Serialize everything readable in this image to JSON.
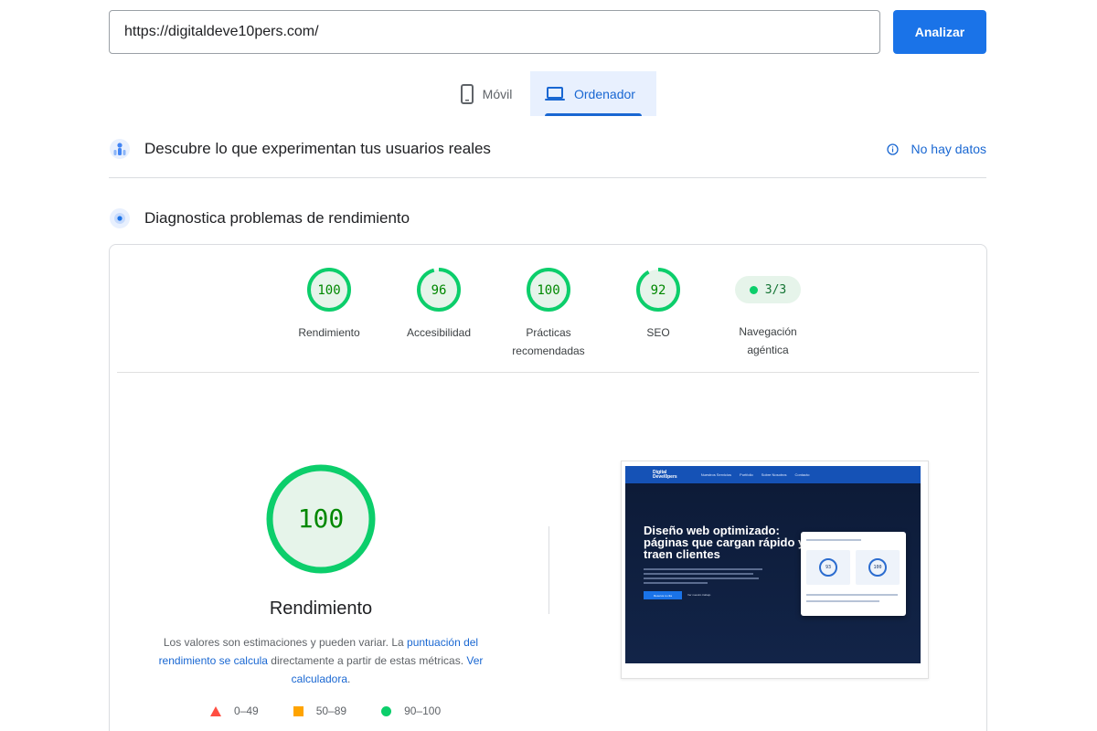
{
  "url_bar": {
    "value": "https://digitaldeve10pers.com/",
    "analyze_label": "Analizar"
  },
  "device_tabs": {
    "mobile_label": "Móvil",
    "desktop_label": "Ordenador",
    "selected": "Ordenador"
  },
  "crux_section": {
    "title": "Descubre lo que experimentan tus usuarios reales",
    "status_link": "No hay datos"
  },
  "diagnostics_section": {
    "title": "Diagnostica problemas de rendimiento"
  },
  "scores": [
    {
      "label": "Rendimiento",
      "value": "100",
      "fraction": 1.0
    },
    {
      "label": "Accesibilidad",
      "value": "96",
      "fraction": 0.96
    },
    {
      "label_line1": "Prácticas",
      "label_line2": "recomendadas",
      "value": "100",
      "fraction": 1.0
    },
    {
      "label": "SEO",
      "value": "92",
      "fraction": 0.92
    }
  ],
  "agentic": {
    "value": "3/3",
    "label_line1": "Navegación",
    "label_line2": "agéntica"
  },
  "performance_detail": {
    "score": "100",
    "fraction": 1.0,
    "title": "Rendimiento",
    "note_prefix": "Los valores son estimaciones y pueden variar. La ",
    "note_link1": "puntuación del rendimiento se calcula",
    "note_middle": " directamente a partir de estas métricas. ",
    "note_link2": "Ver calculadora",
    "note_suffix": "."
  },
  "legend": {
    "fail": "0–49",
    "average": "50–89",
    "pass": "90–100"
  },
  "colors": {
    "pass": "#0cce6b",
    "pass_text": "#008800",
    "pass_bg": "#e6f4ea",
    "average": "#ffa400",
    "fail": "#ff4e42",
    "accent": "#1a73e8"
  },
  "thumbnail": {
    "logo_line1": "Digital",
    "logo_line2": "Devel0pers",
    "nav_items": [
      "Nuestros Servicios",
      "Portfolio",
      "Sobre Nosotros",
      "Contacto"
    ],
    "headline": "Diseño web optimizado: páginas que cargan rápido y traen clientes",
    "cta": "Reserva tu cita",
    "cta_secondary": "Ver nuestro trabajo",
    "mini_scores": [
      "93",
      "100"
    ]
  }
}
